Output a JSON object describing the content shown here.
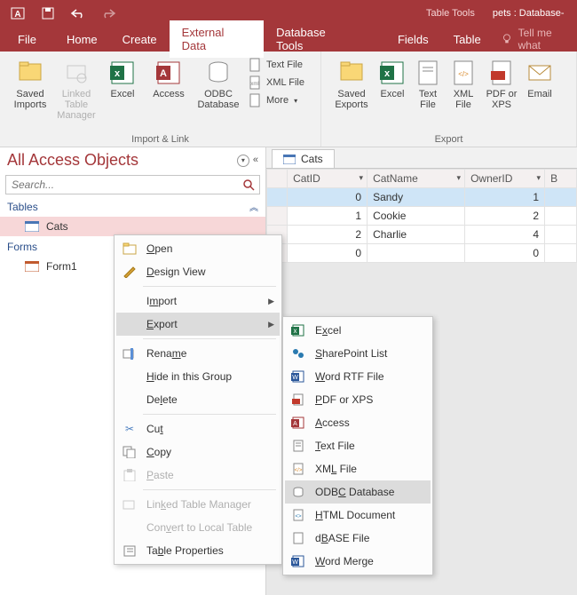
{
  "titlebar": {
    "table_tools": "Table Tools",
    "doc": "pets : Database-"
  },
  "tabs": {
    "file": "File",
    "home": "Home",
    "create": "Create",
    "external": "External Data",
    "dbtools": "Database Tools",
    "fields": "Fields",
    "table": "Table",
    "tellme": "Tell me what"
  },
  "ribbon": {
    "saved_imports": "Saved Imports",
    "linked_table_mgr": "Linked Table Manager",
    "excel": "Excel",
    "access": "Access",
    "odbc": "ODBC Database",
    "text_file": "Text File",
    "xml_file": "XML File",
    "more": "More",
    "saved_exports": "Saved Exports",
    "excel2": "Excel",
    "text_file2": "Text File",
    "xml_file2": "XML File",
    "pdf_xps": "PDF or XPS",
    "email": "Email",
    "g_import": "Import & Link",
    "g_export": "Export"
  },
  "nav": {
    "title": "All Access Objects",
    "search_ph": "Search...",
    "tables": "Tables",
    "cats": "Cats",
    "forms": "Forms",
    "form1": "Form1"
  },
  "doc": {
    "tab": "Cats",
    "cols": [
      "CatID",
      "CatName",
      "OwnerID",
      "B"
    ],
    "rows": [
      {
        "id": "0",
        "name": "Sandy",
        "owner": "1"
      },
      {
        "id": "1",
        "name": "Cookie",
        "owner": "2"
      },
      {
        "id": "2",
        "name": "Charlie",
        "owner": "4"
      },
      {
        "id": "0",
        "name": "",
        "owner": "0"
      }
    ]
  },
  "ctx1": {
    "open": "Open",
    "design": "Design View",
    "import": "Import",
    "export": "Export",
    "rename": "Rename",
    "hide": "Hide in this Group",
    "delete": "Delete",
    "cut": "Cut",
    "copy": "Copy",
    "paste": "Paste",
    "ltm": "Linked Table Manager",
    "convert": "Convert to Local Table",
    "props": "Table Properties"
  },
  "ctx2": {
    "excel": "Excel",
    "sp": "SharePoint List",
    "word": "Word RTF File",
    "pdf": "PDF or XPS",
    "access": "Access",
    "text": "Text File",
    "xml": "XML File",
    "odbc": "ODBC Database",
    "html": "HTML Document",
    "dbase": "dBASE File",
    "merge": "Word Merge"
  }
}
